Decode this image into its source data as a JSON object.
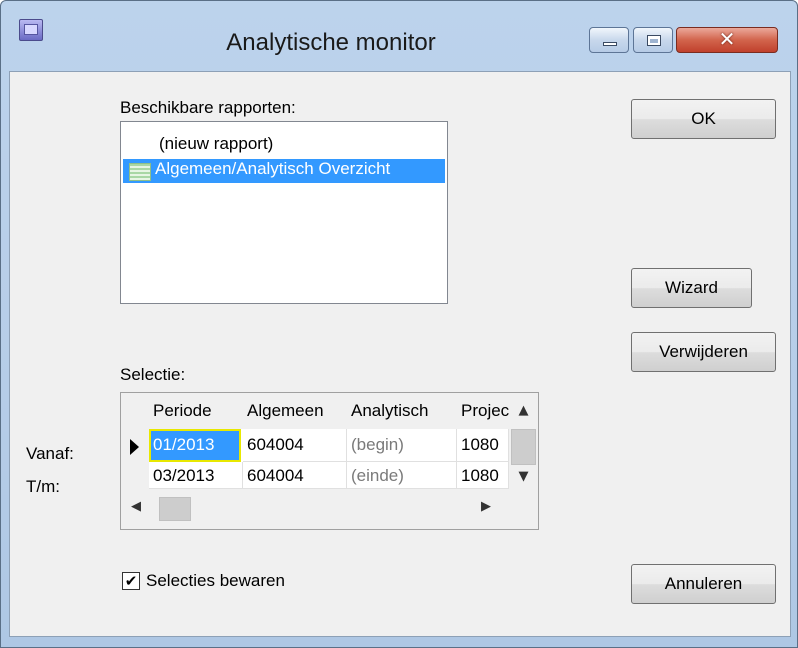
{
  "window": {
    "title": "Analytische monitor",
    "close_glyph": "✕"
  },
  "reports": {
    "label": "Beschikbare rapporten:",
    "items": [
      {
        "label": "(nieuw rapport)",
        "selected": false
      },
      {
        "label": "Algemeen/Analytisch Overzicht",
        "selected": true
      }
    ]
  },
  "buttons": {
    "ok": "OK",
    "wizard": "Wizard",
    "delete": "Verwijderen",
    "cancel": "Annuleren"
  },
  "selection": {
    "label": "Selectie:",
    "row_labels": [
      "Vanaf:",
      "T/m:"
    ],
    "columns": [
      "Periode",
      "Algemeen",
      "Analytisch",
      "Project"
    ],
    "rows": [
      {
        "periode": "01/2013",
        "algemeen": "604004",
        "analytisch": "(begin)",
        "project": "1080"
      },
      {
        "periode": "03/2013",
        "algemeen": "604004",
        "analytisch": "(einde)",
        "project": "1080"
      }
    ]
  },
  "save_selection": {
    "label": "Selecties bewaren",
    "checked": true,
    "check_glyph": "✔"
  },
  "scroll_glyphs": {
    "up": "▲",
    "down": "▼",
    "left": "◀",
    "right": "▶"
  },
  "colors": {
    "selection": "#3399ff",
    "focus_border": "#e8e800",
    "close_button": "#c94a33"
  }
}
